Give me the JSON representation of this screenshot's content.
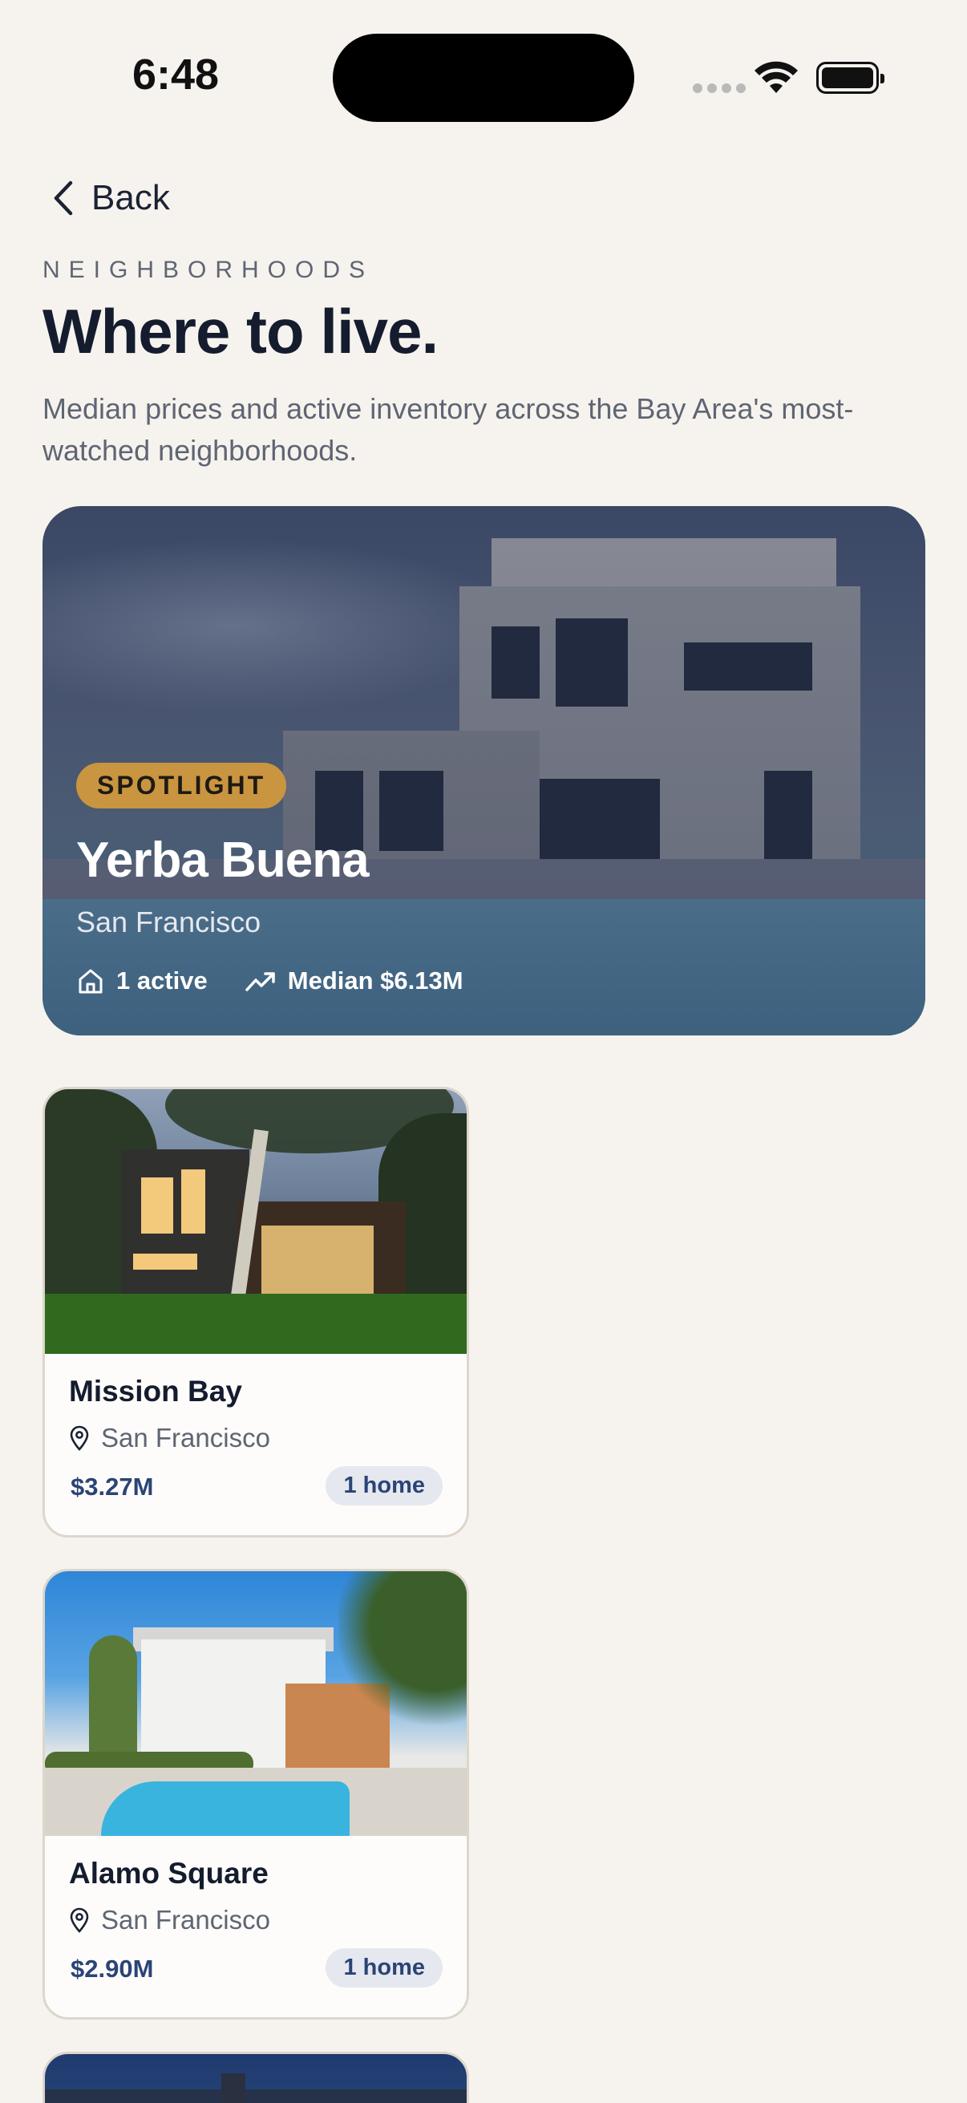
{
  "status_bar": {
    "time": "6:48"
  },
  "nav": {
    "back_label": "Back"
  },
  "header": {
    "eyebrow": "NEIGHBORHOODS",
    "title": "Where to live.",
    "subtitle": "Median prices and active inventory across the Bay Area's most-watched neighborhoods."
  },
  "spotlight": {
    "badge": "SPOTLIGHT",
    "name": "Yerba Buena",
    "city": "San Francisco",
    "active": "1 active",
    "median": "Median $6.13M"
  },
  "neighborhoods": [
    {
      "name": "Mission Bay",
      "city": "San Francisco",
      "price": "$3.27M",
      "count": "1 home"
    },
    {
      "name": "Alamo Square",
      "city": "San Francisco",
      "price": "$2.90M",
      "count": "1 home"
    }
  ],
  "colors": {
    "background": "#f6f3ee",
    "accent": "#c99540",
    "price": "#2b4476",
    "title": "#141c2e"
  },
  "icons": {
    "back": "chevron-left-icon",
    "home": "home-icon",
    "trend": "trending-up-icon",
    "location": "map-pin-icon"
  }
}
